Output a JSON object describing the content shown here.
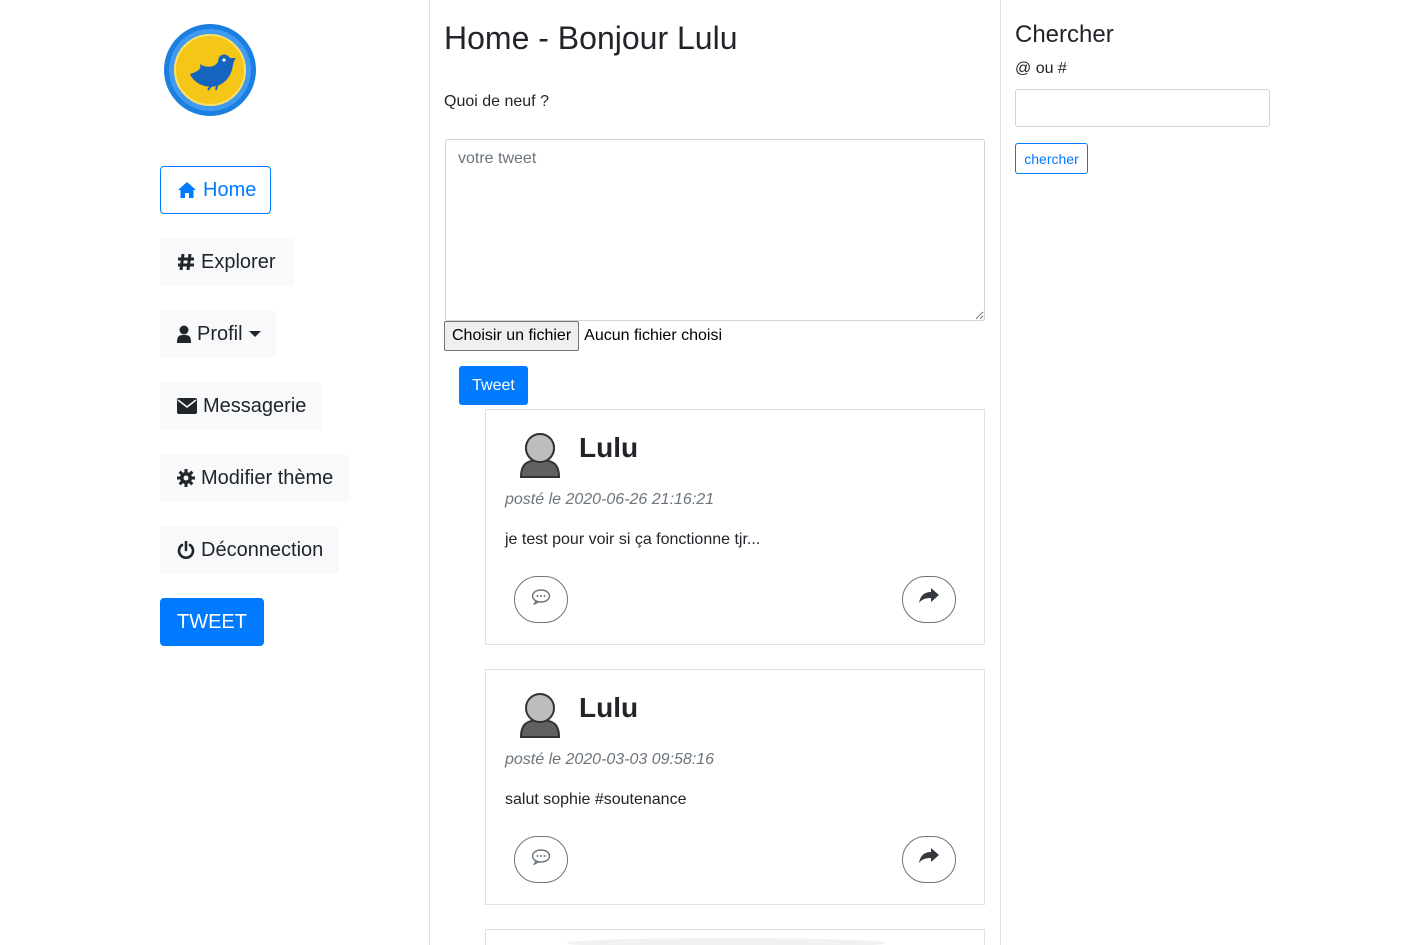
{
  "sidebar": {
    "logo_alt": "bird logo",
    "items": [
      {
        "label": "Home",
        "icon": "home-icon"
      },
      {
        "label": "Explorer",
        "icon": "hashtag-icon"
      },
      {
        "label": "Profil",
        "icon": "user-icon"
      },
      {
        "label": "Messagerie",
        "icon": "envelope-icon"
      },
      {
        "label": "Modifier thème",
        "icon": "gear-icon"
      },
      {
        "label": "Déconnection",
        "icon": "power-icon"
      }
    ],
    "tweet_button": "TWEET"
  },
  "main": {
    "title": "Home - Bonjour Lulu",
    "prompt": "Quoi de neuf ?",
    "tweet_placeholder": "votre tweet",
    "file_button": "Choisir un fichier",
    "file_status": "Aucun fichier choisi",
    "submit_label": "Tweet",
    "tweets": [
      {
        "author": "Lulu",
        "date": "posté le 2020-06-26 21:16:21",
        "text": "je test pour voir si ça fonctionne tjr..."
      },
      {
        "author": "Lulu",
        "date": "posté le 2020-03-03 09:58:16",
        "text": "salut sophie #soutenance"
      }
    ]
  },
  "search": {
    "title": "Chercher",
    "label": "@ ou #",
    "value": "",
    "button": "chercher"
  },
  "colors": {
    "primary": "#007bff",
    "nav_bg": "#f8f9fa",
    "muted": "#6c757d",
    "border": "#dee2e6"
  }
}
